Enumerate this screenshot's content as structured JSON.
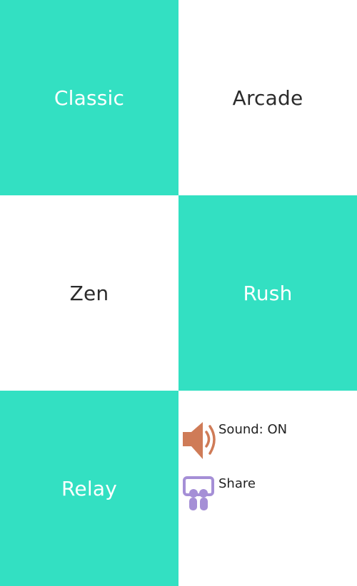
{
  "modes": {
    "classic": "Classic",
    "arcade": "Arcade",
    "zen": "Zen",
    "rush": "Rush",
    "relay": "Relay"
  },
  "settings": {
    "sound_label": "Sound: ON",
    "share_label": "Share"
  },
  "icons": {
    "sound": "speaker-icon",
    "share": "share-icon"
  },
  "colors": {
    "teal": "#33e0c2",
    "speaker": "#cf7b57",
    "share": "#a58fd6"
  }
}
